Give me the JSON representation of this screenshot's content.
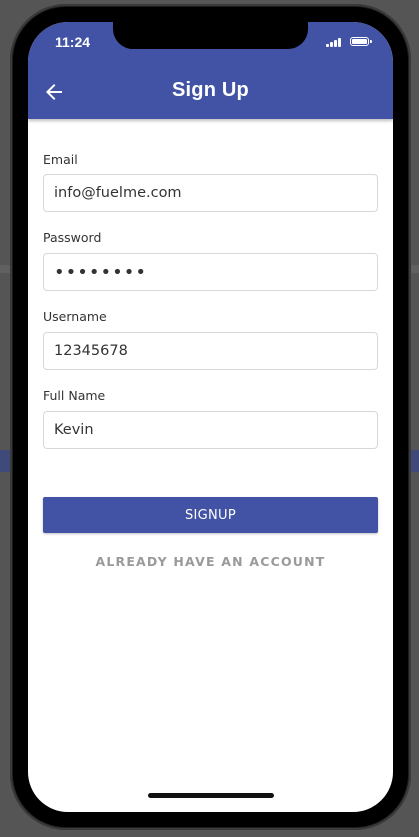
{
  "status_bar": {
    "time": "11:24",
    "signal_icon": "cellular-signal-icon",
    "battery_icon": "battery-full-icon"
  },
  "header": {
    "title": "Sign Up",
    "back_icon": "arrow-left-icon",
    "background_color": "#4253a5"
  },
  "form": {
    "email": {
      "label": "Email",
      "value": "info@fuelme.com"
    },
    "password": {
      "label": "Password",
      "value": "••••••••"
    },
    "username": {
      "label": "Username",
      "value": "12345678"
    },
    "full_name": {
      "label": "Full Name",
      "value": "Kevin"
    }
  },
  "actions": {
    "signup_label": "SIGNUP",
    "already_have_account_label": "ALREADY HAVE AN ACCOUNT"
  }
}
